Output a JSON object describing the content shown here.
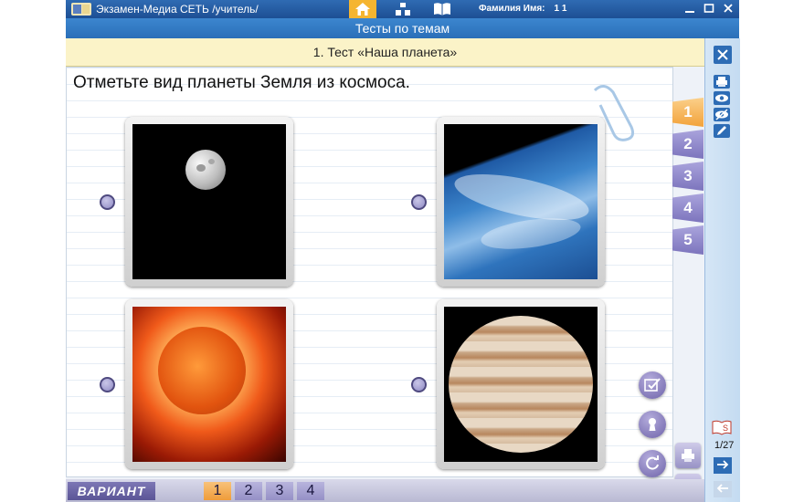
{
  "app": {
    "title": "Экзамен-Медиа СЕТЬ /учитель/",
    "user_label": "Фамилия Имя:",
    "user_value": "1 1",
    "nav_icons": [
      "home-icon",
      "structure-icon",
      "book-icon"
    ]
  },
  "section_title": "Тесты по темам",
  "test_title": "1. Тест «Наша планета»",
  "question": "Отметьте вид планеты Земля из космоса.",
  "options": [
    {
      "image": "moon"
    },
    {
      "image": "earth"
    },
    {
      "image": "sun"
    },
    {
      "image": "jupiter"
    }
  ],
  "question_tabs": [
    "1",
    "2",
    "3",
    "4",
    "5"
  ],
  "active_tab": "1",
  "variant_label": "ВАРИАНТ",
  "variants": [
    "1",
    "2",
    "3",
    "4"
  ],
  "active_variant": "1",
  "pager": "1/27",
  "colors": {
    "titlebar": "#1d4f94",
    "section": "#2a6fb8",
    "test_header_bg": "#fbf3c8",
    "active_orange": "#ef9c3a",
    "tab_purple": "#8b83c4"
  }
}
